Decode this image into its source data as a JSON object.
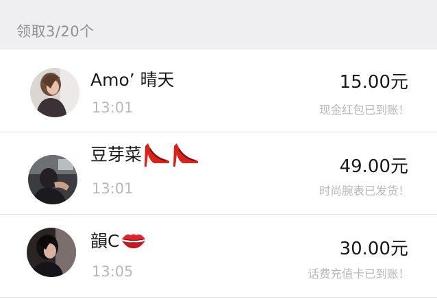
{
  "header": {
    "summary": "领取3/20个"
  },
  "records": [
    {
      "name": "Amo’ 晴天",
      "time": "13:01",
      "amount": "15.00元",
      "status": "现金红包已到账！",
      "emoji": []
    },
    {
      "name": "豆芽菜",
      "time": "13:01",
      "amount": "49.00元",
      "status": "时尚腕表已发货！",
      "emoji": [
        "high-heel-shoe-icon",
        "high-heel-shoe-icon"
      ]
    },
    {
      "name": "韻C",
      "time": "13:05",
      "amount": "30.00元",
      "status": "话费充值卡已到账！",
      "emoji": [
        "kiss-mark-icon"
      ]
    }
  ],
  "colors": {
    "header_bg": "#efeff1",
    "header_text": "#8f8f94",
    "primary_text": "#1a1a1a",
    "secondary_text": "#b8b8bc",
    "divider": "#dcdcde"
  }
}
